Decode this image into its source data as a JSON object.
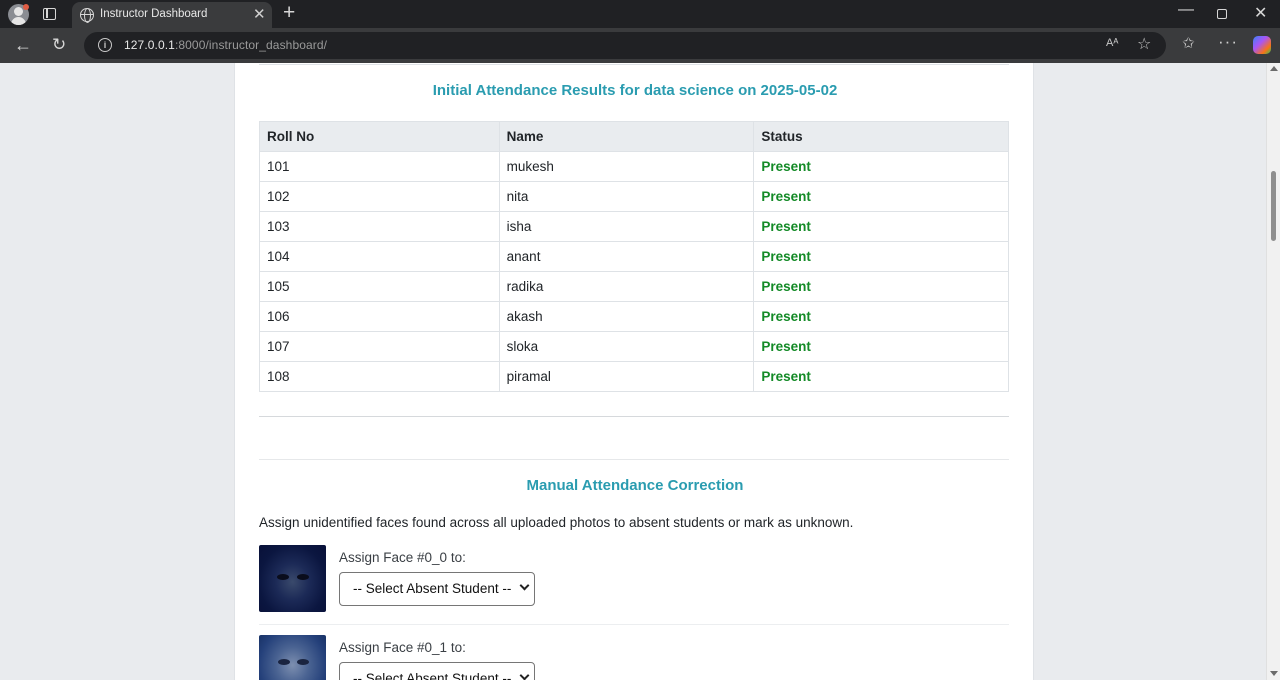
{
  "browser": {
    "tab_title": "Instructor Dashboard",
    "url_host": "127.0.0.1",
    "url_rest": ":8000/instructor_dashboard/",
    "icons": [
      "profile-icon",
      "tab-actions-icon",
      "globe-icon",
      "close-icon",
      "new-tab-icon",
      "minimize-icon",
      "maximize-icon",
      "window-close-icon",
      "back-icon",
      "reload-icon",
      "info-icon",
      "read-aloud-icon",
      "favorite-star-icon",
      "favorites-icon",
      "more-icon",
      "copilot-icon"
    ]
  },
  "attendance": {
    "title": "Initial Attendance Results for data science on 2025-05-02",
    "headers": [
      "Roll No",
      "Name",
      "Status"
    ],
    "rows": [
      {
        "roll": "101",
        "name": "mukesh",
        "status": "Present"
      },
      {
        "roll": "102",
        "name": "nita",
        "status": "Present"
      },
      {
        "roll": "103",
        "name": "isha",
        "status": "Present"
      },
      {
        "roll": "104",
        "name": "anant",
        "status": "Present"
      },
      {
        "roll": "105",
        "name": "radika",
        "status": "Present"
      },
      {
        "roll": "106",
        "name": "akash",
        "status": "Present"
      },
      {
        "roll": "107",
        "name": "sloka",
        "status": "Present"
      },
      {
        "roll": "108",
        "name": "piramal",
        "status": "Present"
      }
    ],
    "status_color": "#138a26"
  },
  "correction": {
    "title": "Manual Attendance Correction",
    "instructions": "Assign unidentified faces found across all uploaded photos to absent students or mark as unknown.",
    "faces": [
      {
        "label": "Assign Face #0_0 to:",
        "select_value": "-- Select Absent Student --"
      },
      {
        "label": "Assign Face #0_1 to:",
        "select_value": "-- Select Absent Student --"
      }
    ]
  },
  "theme": {
    "accent": "#2a9cb0",
    "chrome_dark": "#202124",
    "chrome_mid": "#3a3b3d"
  }
}
